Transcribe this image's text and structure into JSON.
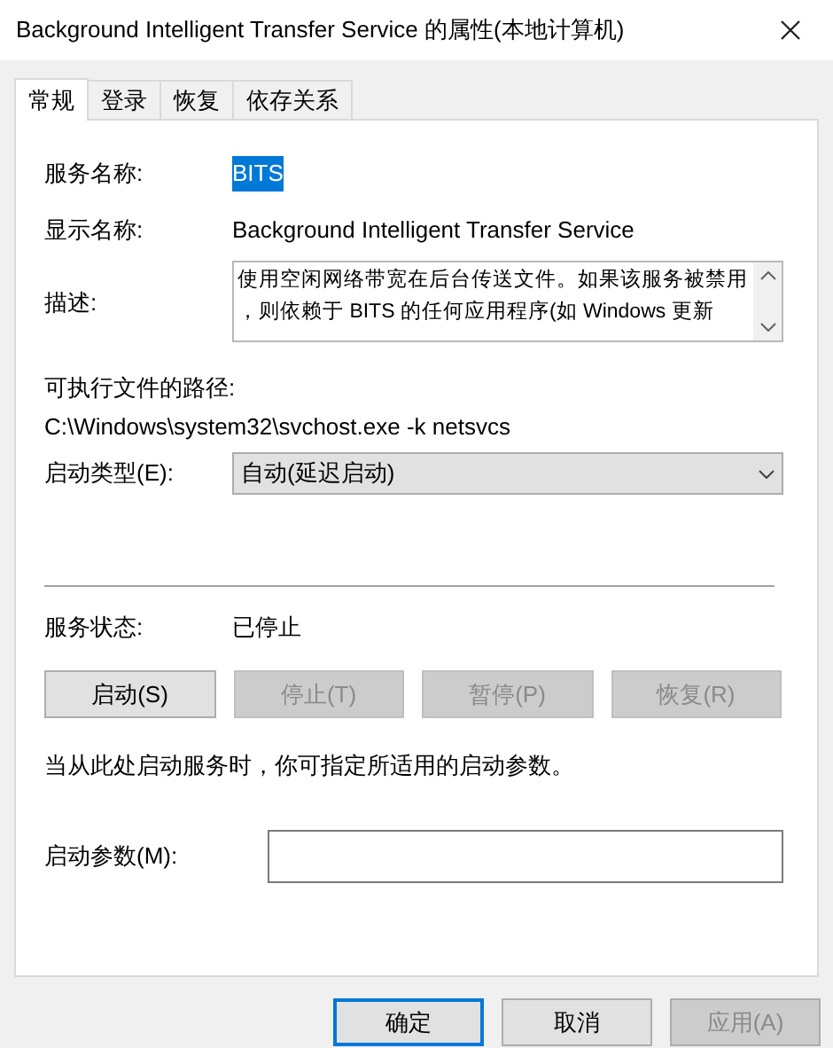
{
  "window": {
    "title": "Background Intelligent Transfer Service 的属性(本地计算机)"
  },
  "tabs": [
    {
      "label": "常规",
      "selected": true
    },
    {
      "label": "登录",
      "selected": false
    },
    {
      "label": "恢复",
      "selected": false
    },
    {
      "label": "依存关系",
      "selected": false
    }
  ],
  "service_name": {
    "label": "服务名称:",
    "value": "BITS",
    "highlighted": true
  },
  "display_name": {
    "label": "显示名称:",
    "value": "Background Intelligent Transfer Service"
  },
  "description": {
    "label": "描述:",
    "lines": [
      "使用空闲网络带宽在后台传送文件。如果该服务被禁用",
      "，则依赖于 BITS 的任何应用程序(如 Windows 更新"
    ]
  },
  "executable_path": {
    "label": "可执行文件的路径:",
    "value": "C:\\Windows\\system32\\svchost.exe -k netsvcs"
  },
  "startup_type": {
    "label": "启动类型(E):",
    "value": "自动(延迟启动)"
  },
  "service_status": {
    "label": "服务状态:",
    "value": "已停止"
  },
  "service_buttons": [
    {
      "label": "启动(S)",
      "disabled": false
    },
    {
      "label": "停止(T)",
      "disabled": true
    },
    {
      "label": "暂停(P)",
      "disabled": true
    },
    {
      "label": "恢复(R)",
      "disabled": true
    }
  ],
  "hint": "当从此处启动服务时，你可指定所适用的启动参数。",
  "start_parameters": {
    "label": "启动参数(M):"
  },
  "dialog_buttons": [
    {
      "label": "确定",
      "default": true,
      "disabled": false
    },
    {
      "label": "取消",
      "default": false,
      "disabled": false
    },
    {
      "label": "应用(A)",
      "default": false,
      "disabled": true
    }
  ]
}
